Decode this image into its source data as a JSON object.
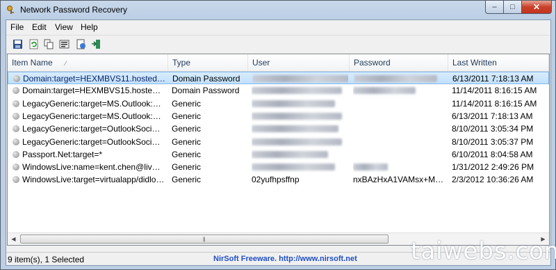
{
  "window": {
    "title": "Network Password Recovery",
    "controls": {
      "minimize": "–",
      "maximize": "□",
      "close": "✕"
    }
  },
  "menu": [
    "File",
    "Edit",
    "View",
    "Help"
  ],
  "toolbar": [
    {
      "name": "save-icon",
      "glyph": "💾"
    },
    {
      "name": "refresh-icon",
      "glyph": "⟳"
    },
    {
      "name": "copy-icon",
      "glyph": "⧉"
    },
    {
      "name": "properties-icon",
      "glyph": "▤"
    },
    {
      "name": "html-report-icon",
      "glyph": "⎙"
    },
    {
      "name": "exit-icon",
      "glyph": "⇥"
    }
  ],
  "columns": [
    "Item Name",
    "Type",
    "User",
    "Password",
    "Last Written"
  ],
  "rows": [
    {
      "item": "Domain:target=HEXMBVS11.hostedms...",
      "type": "Domain Password",
      "user": "",
      "password": "",
      "last_written": "6/13/2011 7:18:13 AM",
      "selected": true
    },
    {
      "item": "Domain:target=HEXMBVS15.hostedms...",
      "type": "Domain Password",
      "user": "",
      "password": "",
      "last_written": "11/14/2011 8:16:15 AM",
      "selected": false
    },
    {
      "item": "LegacyGeneric:target=MS.Outlook:kch...",
      "type": "Generic",
      "user": "",
      "password": "",
      "last_written": "11/14/2011 8:16:15 AM",
      "selected": false
    },
    {
      "item": "LegacyGeneric:target=MS.Outlook:kch...",
      "type": "Generic",
      "user": "",
      "password": "",
      "last_written": "6/13/2011 7:18:13 AM",
      "selected": false
    },
    {
      "item": "LegacyGeneric:target=OutlookSocialC...",
      "type": "Generic",
      "user": "",
      "password": "",
      "last_written": "8/10/2011 3:05:34 PM",
      "selected": false
    },
    {
      "item": "LegacyGeneric:target=OutlookSocialC...",
      "type": "Generic",
      "user": "",
      "password": "",
      "last_written": "8/10/2011 3:05:37 PM",
      "selected": false
    },
    {
      "item": "Passport.Net:target=*",
      "type": "Generic",
      "user": "",
      "password": "",
      "last_written": "6/10/2011 8:04:58 AM",
      "selected": false
    },
    {
      "item": "WindowsLive:name=kent.chen@live.c...",
      "type": "Generic",
      "user": "",
      "password": "",
      "last_written": "1/31/2012 2:49:26 PM",
      "selected": false
    },
    {
      "item": "WindowsLive:target=virtualapp/didlog...",
      "type": "Generic",
      "user": "02yufhpsffnp",
      "password": "nxBAzHxA1VAMsx+MrZ...",
      "last_written": "2/3/2012 10:36:26 AM",
      "selected": false
    }
  ],
  "status": {
    "count": "9 item(s), 1 Selected",
    "link": "NirSoft Freeware.  http://www.nirsoft.net"
  },
  "watermark": "taiwebs.com"
}
